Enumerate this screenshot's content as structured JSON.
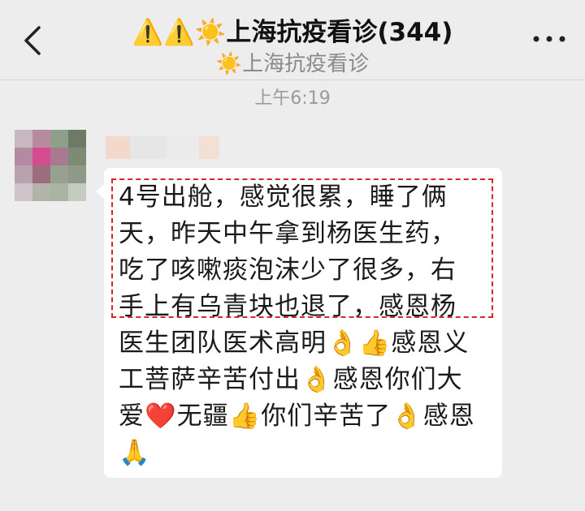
{
  "header": {
    "title": "⚠️⚠️☀️上海抗疫看诊(344)",
    "subtitle": "☀️上海抗疫看诊",
    "back_icon": "chevron-left-icon",
    "more_icon": "more-dots-icon"
  },
  "chat": {
    "timestamp": "上午6:19",
    "message": {
      "lines": [
        "4号出舱，感觉很累，睡了俩",
        "天，昨天中午拿到杨医生药，",
        "吃了咳嗽痰泡沫少了很多，右",
        "手上有乌青块也退了，感恩杨",
        "医生团队医术高明👌👍感恩义",
        "工菩萨辛苦付出👌感恩你们大",
        "爱❤️无疆👍你们辛苦了👌感恩",
        "🙏"
      ]
    }
  },
  "colors": {
    "background": "#ededed",
    "bubble": "#ffffff",
    "highlight_border": "#d8242b"
  }
}
